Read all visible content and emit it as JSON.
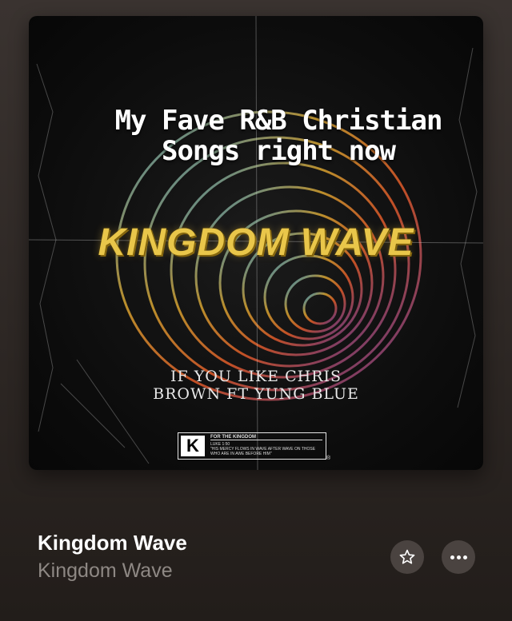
{
  "artwork": {
    "overlay_title": "My Fave R&B Christian Songs right now",
    "big_title": "KINGDOM WAVE",
    "subtitle_line1": "IF YOU LIKE CHRIS",
    "subtitle_line2": "BROWN FT YUNG BLUE",
    "label_k": "K",
    "label_header": "FOR THE KINGDOM",
    "label_verse": "LUKE 1:50",
    "label_quote": "\"HIS MERCY FLOWS IN WAVE AFTER WAVE ON THOSE WHO ARE IN AWE BEFORE HIM\"",
    "registered_mark": "®"
  },
  "track": {
    "title": "Kingdom Wave",
    "artist": "Kingdom Wave"
  },
  "icons": {
    "favorite": "star-icon",
    "more": "ellipsis-icon"
  }
}
